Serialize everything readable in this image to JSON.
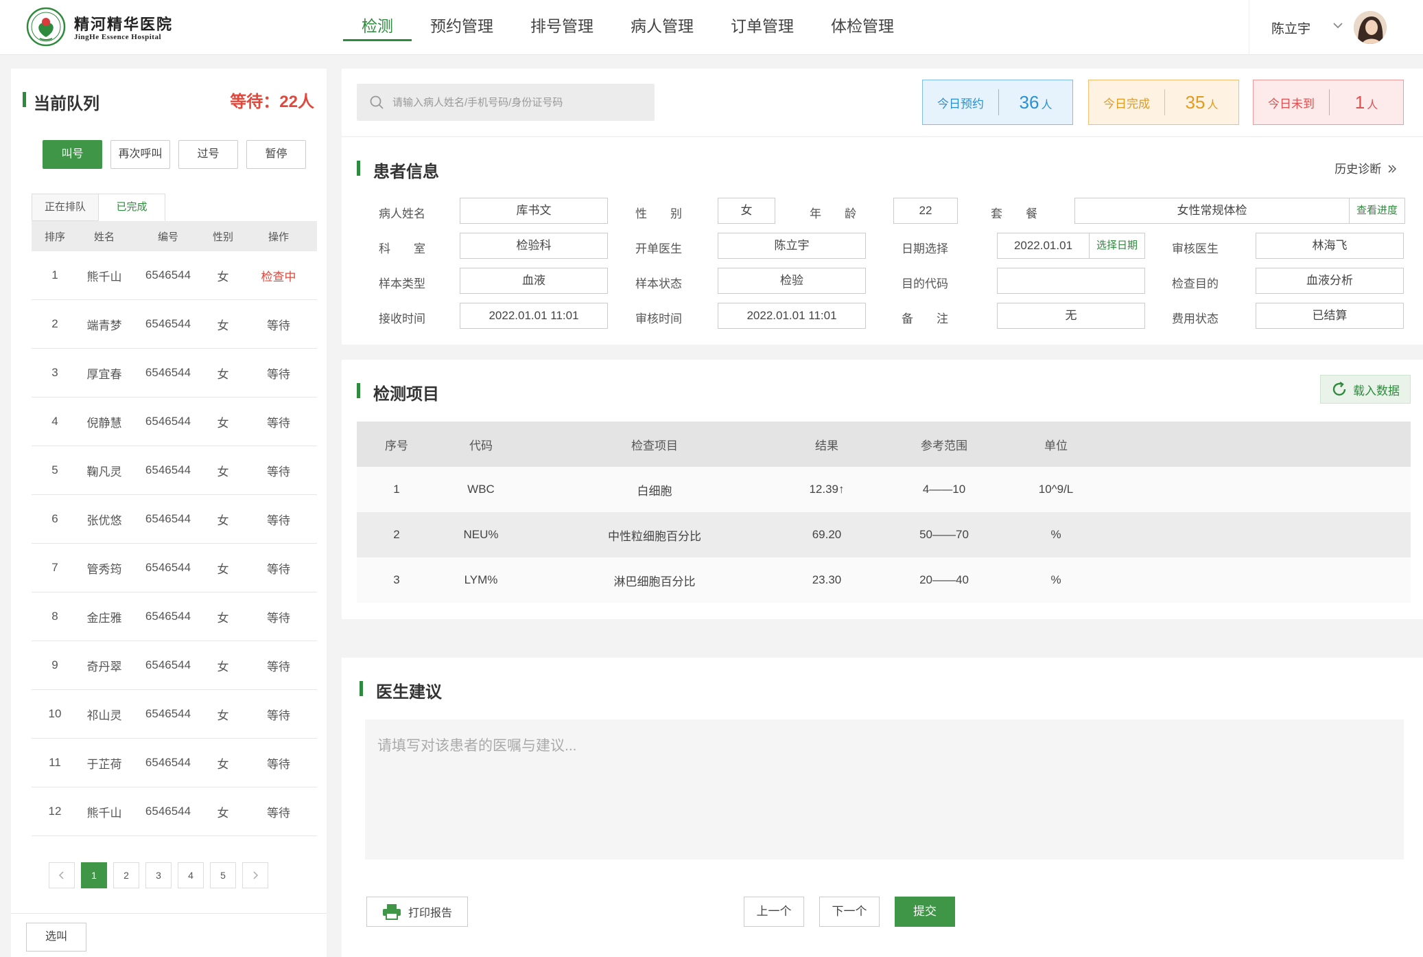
{
  "header": {
    "logo_cn": "精河精华医院",
    "logo_en": "JingHe Essence Hospital",
    "nav": [
      "检测",
      "预约管理",
      "排号管理",
      "病人管理",
      "订单管理",
      "体检管理"
    ],
    "user_name": "陈立宇"
  },
  "queue": {
    "title": "当前队列",
    "waiting": "等待：22人",
    "buttons": [
      "叫号",
      "再次呼叫",
      "过号",
      "暂停"
    ],
    "tabs": [
      "正在排队",
      "已完成"
    ],
    "columns": [
      "排序",
      "姓名",
      "编号",
      "性别",
      "操作"
    ],
    "rows": [
      {
        "no": "1",
        "name": "熊千山",
        "id": "6546544",
        "sex": "女",
        "status": "检查中"
      },
      {
        "no": "2",
        "name": "端青梦",
        "id": "6546544",
        "sex": "女",
        "status": "等待"
      },
      {
        "no": "3",
        "name": "厚宜春",
        "id": "6546544",
        "sex": "女",
        "status": "等待"
      },
      {
        "no": "4",
        "name": "倪静慧",
        "id": "6546544",
        "sex": "女",
        "status": "等待"
      },
      {
        "no": "5",
        "name": "鞠凡灵",
        "id": "6546544",
        "sex": "女",
        "status": "等待"
      },
      {
        "no": "6",
        "name": "张优悠",
        "id": "6546544",
        "sex": "女",
        "status": "等待"
      },
      {
        "no": "7",
        "name": "管秀筠",
        "id": "6546544",
        "sex": "女",
        "status": "等待"
      },
      {
        "no": "8",
        "name": "金庄雅",
        "id": "6546544",
        "sex": "女",
        "status": "等待"
      },
      {
        "no": "9",
        "name": "奇丹翠",
        "id": "6546544",
        "sex": "女",
        "status": "等待"
      },
      {
        "no": "10",
        "name": "祁山灵",
        "id": "6546544",
        "sex": "女",
        "status": "等待"
      },
      {
        "no": "11",
        "name": "于芷荷",
        "id": "6546544",
        "sex": "女",
        "status": "等待"
      },
      {
        "no": "12",
        "name": "熊千山",
        "id": "6546544",
        "sex": "女",
        "status": "等待"
      }
    ],
    "pages": [
      "1",
      "2",
      "3",
      "4",
      "5"
    ],
    "current_page": "1",
    "select_call": "选叫"
  },
  "search": {
    "placeholder": "请输入病人姓名/手机号码/身份证号码"
  },
  "stats": {
    "appointments": {
      "label": "今日预约",
      "value": "36",
      "unit": "人"
    },
    "completed": {
      "label": "今日完成",
      "value": "35",
      "unit": "人"
    },
    "absent": {
      "label": "今日未到",
      "value": "1",
      "unit": "人"
    }
  },
  "patient": {
    "title": "患者信息",
    "history": "历史诊断",
    "fields": {
      "name_label": "病人姓名",
      "name": "库书文",
      "sex_label": "性　　别",
      "sex": "女",
      "age_label": "年　　龄",
      "age": "22",
      "package_label": "套　　餐",
      "package": "女性常规体检",
      "package_btn": "查看进度",
      "dept_label": "科　　室",
      "dept": "检验科",
      "doctor_label": "开单医生",
      "doctor": "陈立宇",
      "date_label": "日期选择",
      "date": "2022.01.01",
      "date_btn": "选择日期",
      "reviewer_label": "审核医生",
      "reviewer": "林海飞",
      "sample_type_label": "样本类型",
      "sample_type": "血液",
      "sample_state_label": "样本状态",
      "sample_state": "检验",
      "purpose_code_label": "目的代码",
      "purpose_code": "",
      "purpose_label": "检查目的",
      "purpose": "血液分析",
      "receive_label": "接收时间",
      "receive": "2022.01.01 11:01",
      "review_time_label": "审核时间",
      "review_time": "2022.01.01 11:01",
      "note_label": "备　　注",
      "note": "无",
      "fee_label": "费用状态",
      "fee": "已结算"
    }
  },
  "tests": {
    "title": "检测项目",
    "load_btn": "载入数据",
    "columns": [
      "序号",
      "代码",
      "检查项目",
      "结果",
      "参考范围",
      "单位"
    ],
    "rows": [
      {
        "no": "1",
        "code": "WBC",
        "item": "白细胞",
        "result": "12.39↑",
        "range": "4——10",
        "unit": "10^9/L"
      },
      {
        "no": "2",
        "code": "NEU%",
        "item": "中性粒细胞百分比",
        "result": "69.20",
        "range": "50——70",
        "unit": "%"
      },
      {
        "no": "3",
        "code": "LYM%",
        "item": "淋巴细胞百分比",
        "result": "23.30",
        "range": "20——40",
        "unit": "%"
      }
    ]
  },
  "advice": {
    "title": "医生建议",
    "placeholder": "请填写对该患者的医嘱与建议...",
    "print_btn": "打印报告",
    "prev_btn": "上一个",
    "next_btn": "下一个",
    "submit_btn": "提交"
  },
  "colors": {
    "brand_green": "#3e9646",
    "alert_red": "#e0483b"
  }
}
